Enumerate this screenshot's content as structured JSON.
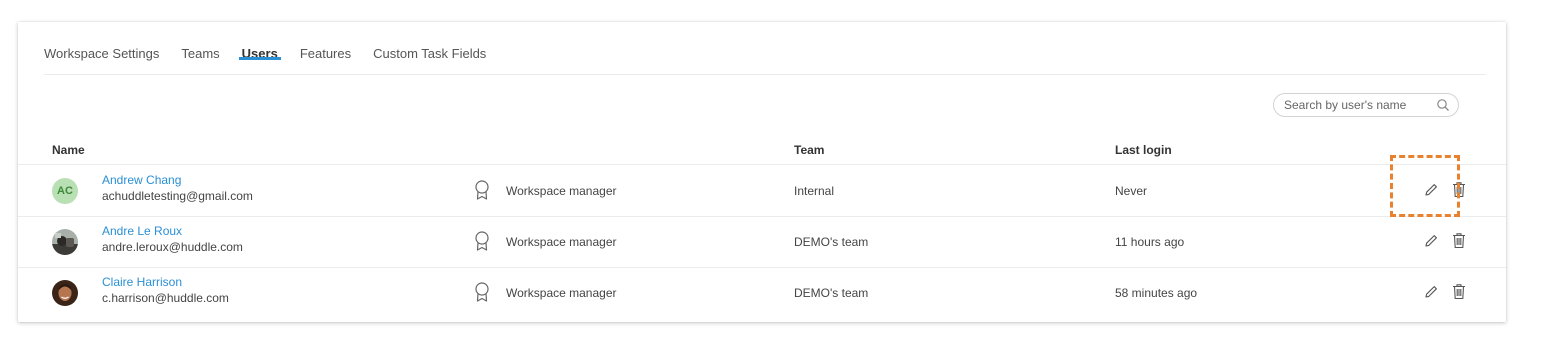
{
  "tabs": [
    {
      "label": "Workspace Settings",
      "active": false
    },
    {
      "label": "Teams",
      "active": false
    },
    {
      "label": "Users",
      "active": true
    },
    {
      "label": "Features",
      "active": false
    },
    {
      "label": "Custom Task Fields",
      "active": false
    }
  ],
  "search": {
    "placeholder": "Search by user's name",
    "icon": "search-icon"
  },
  "table": {
    "headers": {
      "name": "Name",
      "team": "Team",
      "last_login": "Last login"
    },
    "rows": [
      {
        "name": "Andrew Chang",
        "email": "achuddletesting@gmail.com",
        "initials": "AC",
        "role": "Workspace manager",
        "team": "Internal",
        "last_login": "Never"
      },
      {
        "name": "Andre Le Roux",
        "email": "andre.leroux@huddle.com",
        "role": "Workspace manager",
        "team": "DEMO's team",
        "last_login": "11 hours ago"
      },
      {
        "name": "Claire Harrison",
        "email": "c.harrison@huddle.com",
        "role": "Workspace manager",
        "team": "DEMO's team",
        "last_login": "58 minutes ago"
      }
    ]
  },
  "colors": {
    "accent": "#2a8fd4",
    "highlight": "#e8822f",
    "avatar_bg": "#b9dfb4"
  }
}
